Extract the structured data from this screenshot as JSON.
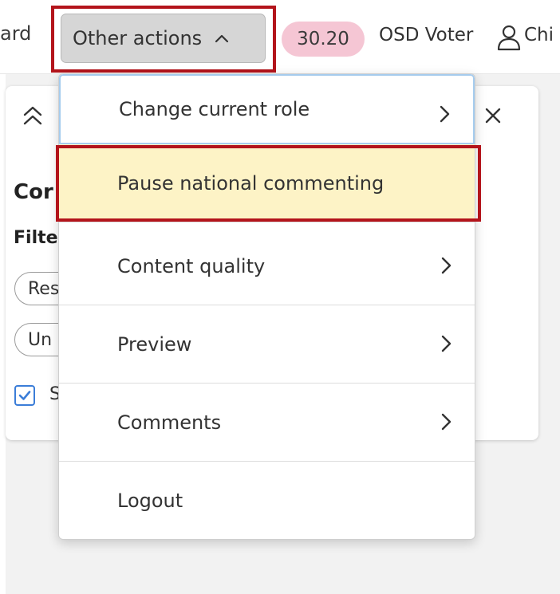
{
  "topbar": {
    "nav_cut_label": "ard",
    "other_actions_label": "Other actions",
    "stage_badge": "30.20",
    "role_label": "OSD Voter",
    "user_name_cut": "Chi"
  },
  "panel": {
    "title_cut": "Cor",
    "filter_cut": "Filte",
    "chips": [
      "Res",
      "Un"
    ],
    "checkbox_label_cut": "S",
    "checkbox_checked": true
  },
  "menu": {
    "items": [
      {
        "label": "Change current role",
        "has_submenu": true
      },
      {
        "label": "Pause national commenting",
        "has_submenu": false
      },
      {
        "label": "Content quality",
        "has_submenu": true
      },
      {
        "label": "Preview",
        "has_submenu": true
      },
      {
        "label": "Comments",
        "has_submenu": true
      },
      {
        "label": "Logout",
        "has_submenu": false
      }
    ]
  },
  "colors": {
    "highlight": "#b3141b",
    "badge": "#f5c6d4",
    "hovered_item": "#fdf3c6",
    "focused_border": "#a6ccee",
    "checkbox": "#3b7dd8"
  },
  "icons": [
    "chevron-up-icon",
    "user-icon",
    "double-chevron-up-icon",
    "close-icon",
    "chevron-right-icon",
    "check-icon"
  ]
}
